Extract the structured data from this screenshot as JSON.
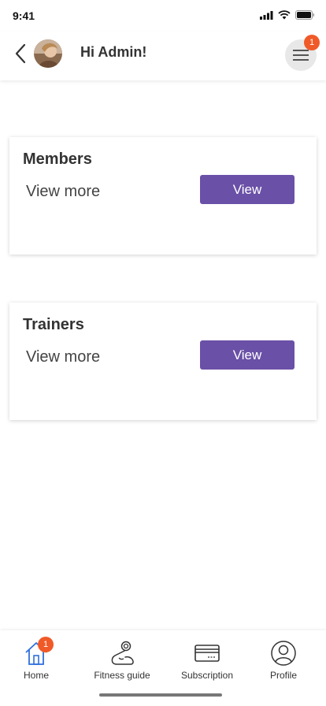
{
  "status_bar": {
    "time": "9:41"
  },
  "header": {
    "greeting": "Hi Admin!",
    "notification_count": "1"
  },
  "cards": [
    {
      "title": "Members",
      "subtitle": "View more",
      "button_label": "View"
    },
    {
      "title": "Trainers",
      "subtitle": "View more",
      "button_label": "View"
    }
  ],
  "tab_bar": {
    "items": [
      {
        "label": "Home",
        "icon": "home-icon",
        "badge": "1",
        "active": true
      },
      {
        "label": "Fitness guide",
        "icon": "fitness-icon"
      },
      {
        "label": "Subscription",
        "icon": "card-icon"
      },
      {
        "label": "Profile",
        "icon": "profile-icon"
      }
    ]
  },
  "colors": {
    "accent": "#6a50a7",
    "badge": "#f05a28",
    "active_tab": "#2f6fdc"
  }
}
